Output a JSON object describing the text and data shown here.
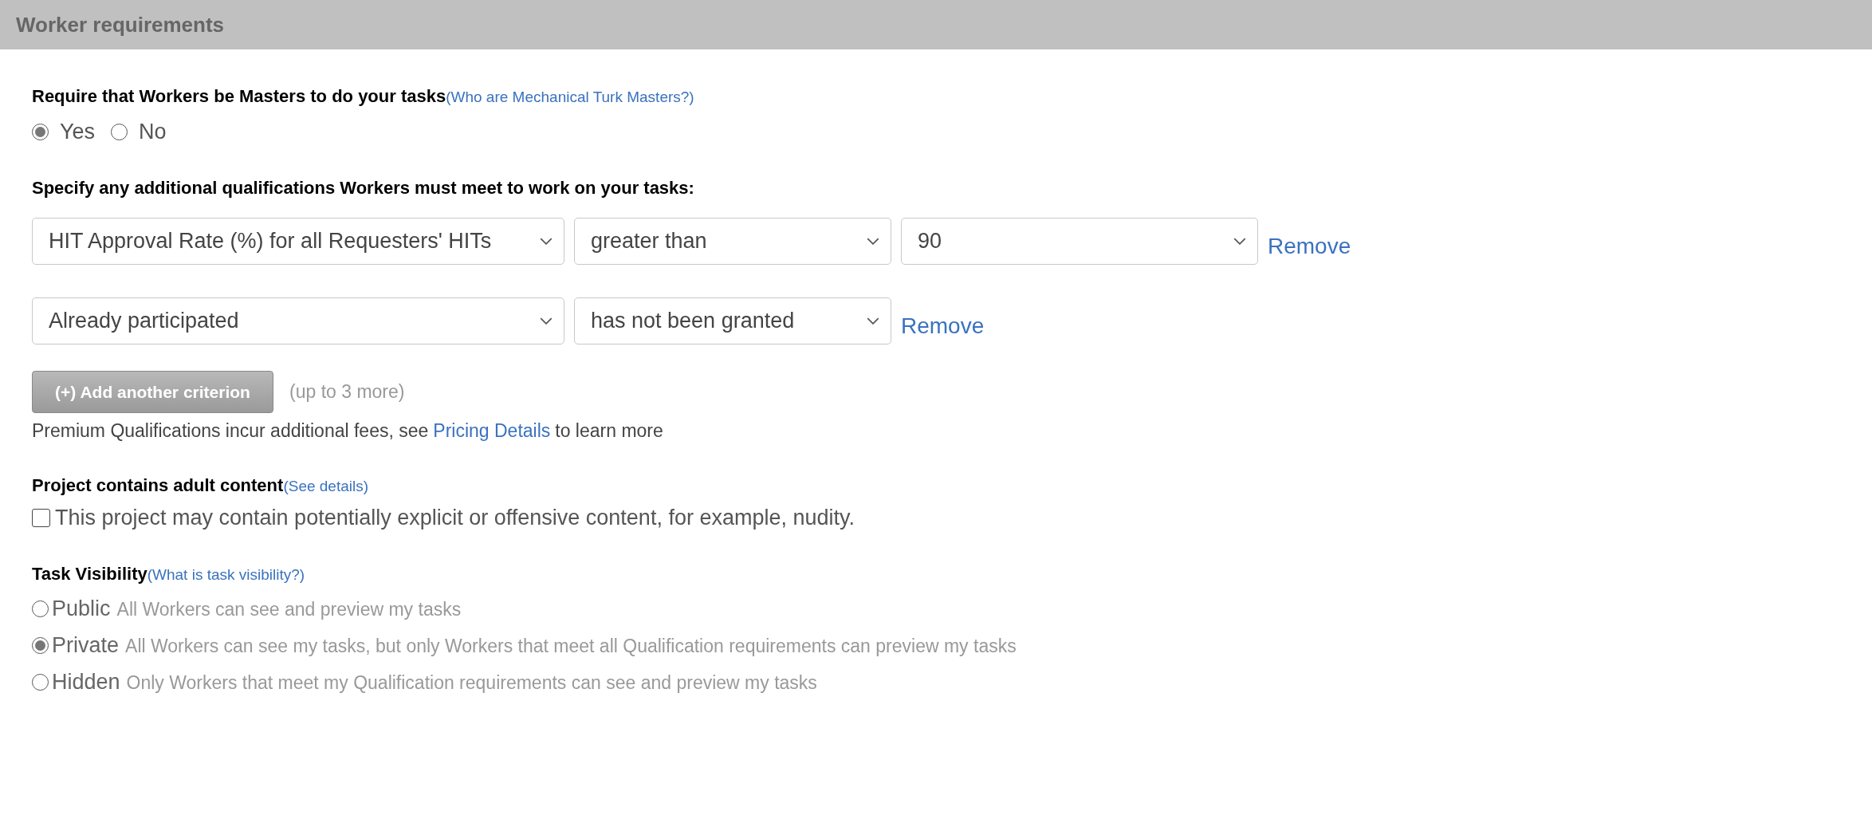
{
  "header": {
    "title": "Worker requirements"
  },
  "masters": {
    "label": "Require that Workers be Masters to do your tasks",
    "help_link": "(Who are Mechanical Turk Masters?)",
    "options": [
      {
        "label": "Yes",
        "selected": true
      },
      {
        "label": "No",
        "selected": false
      }
    ]
  },
  "qualifications": {
    "label": "Specify any additional qualifications Workers must meet to work on your tasks:",
    "criteria": [
      {
        "fields": [
          "HIT Approval Rate (%) for all Requesters' HITs",
          "greater than",
          "90"
        ],
        "remove": "Remove"
      },
      {
        "fields": [
          "Already participated",
          "has not been granted"
        ],
        "remove": "Remove"
      }
    ],
    "add_button": {
      "label": "(+) Add another criterion",
      "disabled": true
    },
    "add_note": "(up to 3 more)",
    "fees_note": {
      "before": "Premium Qualifications incur additional fees, see",
      "link": "Pricing Details",
      "after": "to learn more"
    }
  },
  "adult_content": {
    "label": "Project contains adult content",
    "help_link": "(See details)",
    "checkbox": {
      "label": "This project may contain potentially explicit or offensive content, for example, nudity.",
      "checked": false
    }
  },
  "visibility": {
    "label": "Task Visibility",
    "help_link": "(What is task visibility?)",
    "options": [
      {
        "label": "Public",
        "description": "All Workers can see and preview my tasks",
        "selected": false
      },
      {
        "label": "Private",
        "description": "All Workers can see my tasks, but only Workers that meet all Qualification requirements can preview my tasks",
        "selected": true
      },
      {
        "label": "Hidden",
        "description": "Only Workers that meet my Qualification requirements can see and preview my tasks",
        "selected": false
      }
    ]
  }
}
